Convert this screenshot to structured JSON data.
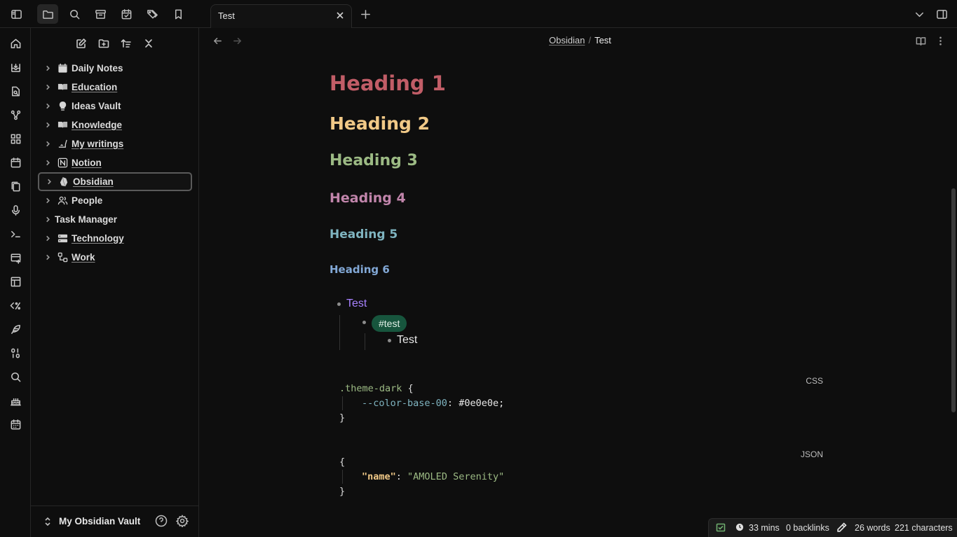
{
  "tab": {
    "title": "Test"
  },
  "breadcrumb": {
    "parent": "Obsidian",
    "separator": "/",
    "current": "Test"
  },
  "sidebar": {
    "items": [
      {
        "label": "Daily Notes",
        "icon": "calendar-icon",
        "underlined": false
      },
      {
        "label": "Education",
        "icon": "book-open-icon",
        "underlined": true
      },
      {
        "label": "Ideas Vault",
        "icon": "lightbulb-icon",
        "underlined": false
      },
      {
        "label": "Knowledge",
        "icon": "book-open-icon",
        "underlined": true
      },
      {
        "label": "My writings",
        "icon": "writing-hand-icon",
        "underlined": true
      },
      {
        "label": "Notion",
        "icon": "notion-icon",
        "underlined": true
      },
      {
        "label": "Obsidian",
        "icon": "obsidian-icon",
        "underlined": true
      },
      {
        "label": "People",
        "icon": "people-icon",
        "underlined": false
      },
      {
        "label": "Task Manager",
        "icon": "",
        "underlined": false
      },
      {
        "label": "Technology",
        "icon": "server-icon",
        "underlined": true
      },
      {
        "label": "Work",
        "icon": "workflow-icon",
        "underlined": true
      }
    ],
    "selected": "Obsidian"
  },
  "vault": {
    "name": "My Obsidian Vault"
  },
  "note": {
    "h1": "Heading 1",
    "h2": "Heading 2",
    "h3": "Heading 3",
    "h4": "Heading 4",
    "h5": "Heading 5",
    "h6": "Heading 6",
    "list": {
      "level1": "Test",
      "tag": "#test",
      "level3": "Test"
    },
    "code_css": {
      "lang": "CSS",
      "selector": ".theme-dark",
      "open": " {",
      "property": "--color-base-00",
      "colon": ": ",
      "value": "#0e0e0e;",
      "close": "}"
    },
    "code_json": {
      "lang": "JSON",
      "open": "{",
      "key": "\"name\"",
      "colon": ": ",
      "value": "\"AMOLED Serenity\"",
      "close": "}"
    }
  },
  "status": {
    "time": "33 mins",
    "backlinks": "0 backlinks",
    "words": "26 words",
    "characters": "221 characters"
  },
  "colors": {
    "background": "#0e0e0e",
    "h1": "#c15d67",
    "h2": "#f1c987",
    "h3": "#9cba84",
    "h4": "#c185ab",
    "h5": "#7fb4c0",
    "h6": "#82a8d6",
    "link": "#a882ff",
    "tag_bg": "#17553d"
  }
}
